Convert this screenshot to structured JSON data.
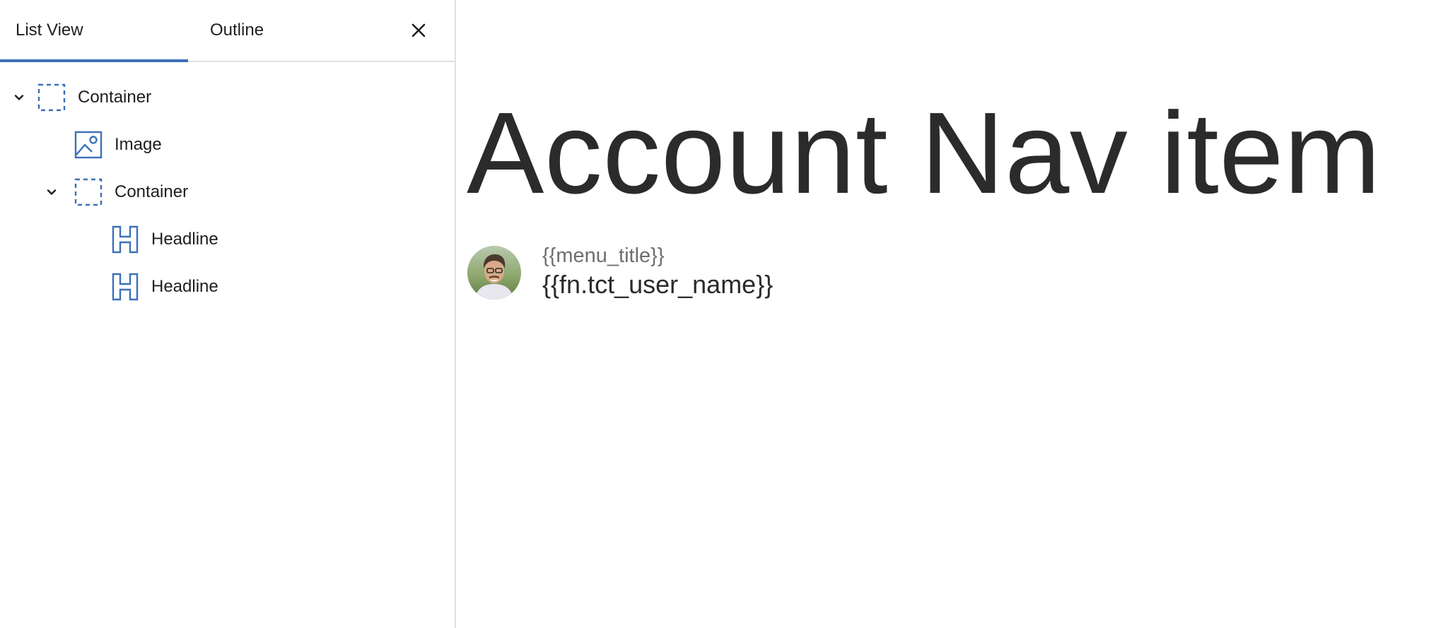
{
  "panel": {
    "tabs": [
      {
        "label": "List View",
        "active": true
      },
      {
        "label": "Outline",
        "active": false
      }
    ],
    "close_icon": "close-icon",
    "accent_color": "#3b70b8"
  },
  "tree": {
    "items": [
      {
        "label": "Container",
        "icon": "container-icon",
        "expanded": true,
        "depth": 0
      },
      {
        "label": "Image",
        "icon": "image-icon",
        "depth": 1
      },
      {
        "label": "Container",
        "icon": "container-icon",
        "expanded": true,
        "depth": 1
      },
      {
        "label": "Headline",
        "icon": "headline-icon",
        "depth": 2
      },
      {
        "label": "Headline",
        "icon": "headline-icon",
        "depth": 2
      }
    ]
  },
  "canvas": {
    "title": "Account Nav item",
    "account": {
      "menu_title": "{{menu_title}}",
      "user_name": "{{fn.tct_user_name}}",
      "avatar_icon": "user-avatar"
    }
  }
}
